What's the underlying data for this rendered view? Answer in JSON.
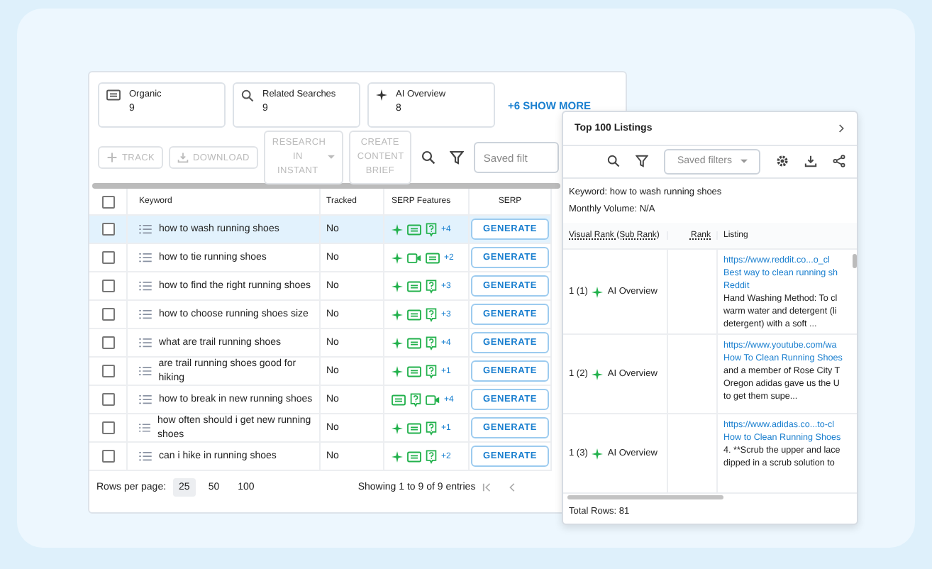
{
  "stats": [
    {
      "kind": "serp",
      "label": "Organic",
      "value": "9"
    },
    {
      "kind": "search",
      "label": "Related Searches",
      "value": "9"
    },
    {
      "kind": "ai",
      "label": "AI Overview",
      "value": "8"
    }
  ],
  "show_more": "+6 SHOW MORE",
  "toolbar": {
    "buttons": [
      {
        "kind": "plus",
        "label": "TRACK",
        "disabled": true
      },
      {
        "kind": "download",
        "label": "DOWNLOAD",
        "disabled": true
      },
      {
        "kind": "caret",
        "label": "RESEARCH IN INSTANT",
        "disabled": true
      },
      {
        "kind": "plain",
        "label": "CREATE CONTENT BRIEF",
        "disabled": true
      }
    ],
    "saved_filters": "Saved filt"
  },
  "table": {
    "all_checked": false,
    "columns": [
      "Keyword",
      "Tracked",
      "SERP Features",
      "SERP"
    ],
    "rows": [
      {
        "selected": true,
        "checked": false,
        "keyword": "how to wash running shoes",
        "tracked": "No",
        "features": [
          {
            "kind": "ai"
          },
          {
            "kind": "serp"
          },
          {
            "kind": "faq"
          }
        ],
        "more": "+4",
        "action": "GENERATE"
      },
      {
        "selected": false,
        "checked": false,
        "keyword": "how to tie running shoes",
        "tracked": "No",
        "features": [
          {
            "kind": "ai"
          },
          {
            "kind": "video"
          },
          {
            "kind": "serp"
          }
        ],
        "more": "+2",
        "action": "GENERATE"
      },
      {
        "selected": false,
        "checked": false,
        "keyword": "how to find the right running shoes",
        "tracked": "No",
        "features": [
          {
            "kind": "ai"
          },
          {
            "kind": "serp"
          },
          {
            "kind": "faq"
          }
        ],
        "more": "+3",
        "action": "GENERATE"
      },
      {
        "selected": false,
        "checked": false,
        "keyword": "how to choose running shoes size",
        "tracked": "No",
        "features": [
          {
            "kind": "ai"
          },
          {
            "kind": "serp"
          },
          {
            "kind": "faq"
          }
        ],
        "more": "+3",
        "action": "GENERATE"
      },
      {
        "selected": false,
        "checked": false,
        "keyword": "what are trail running shoes",
        "tracked": "No",
        "features": [
          {
            "kind": "ai"
          },
          {
            "kind": "serp"
          },
          {
            "kind": "faq"
          }
        ],
        "more": "+4",
        "action": "GENERATE"
      },
      {
        "selected": false,
        "checked": false,
        "keyword": "are trail running shoes good for hiking",
        "tracked": "No",
        "features": [
          {
            "kind": "ai"
          },
          {
            "kind": "serp"
          },
          {
            "kind": "faq"
          }
        ],
        "more": "+1",
        "action": "GENERATE"
      },
      {
        "selected": false,
        "checked": false,
        "keyword": "how to break in new running shoes",
        "tracked": "No",
        "features": [
          {
            "kind": "serp"
          },
          {
            "kind": "faq"
          },
          {
            "kind": "video"
          }
        ],
        "more": "+4",
        "action": "GENERATE"
      },
      {
        "selected": false,
        "checked": false,
        "keyword": "how often should i get new running shoes",
        "tracked": "No",
        "features": [
          {
            "kind": "ai"
          },
          {
            "kind": "serp"
          },
          {
            "kind": "faq"
          }
        ],
        "more": "+1",
        "action": "GENERATE"
      },
      {
        "selected": false,
        "checked": false,
        "keyword": "can i hike in running shoes",
        "tracked": "No",
        "features": [
          {
            "kind": "ai"
          },
          {
            "kind": "serp"
          },
          {
            "kind": "faq"
          }
        ],
        "more": "+2",
        "action": "GENERATE"
      }
    ]
  },
  "pagination": {
    "label": "Rows per page:",
    "sizes": [
      {
        "label": "25",
        "selected": true
      },
      {
        "label": "50",
        "selected": false
      },
      {
        "label": "100",
        "selected": false
      }
    ],
    "summary": "Showing 1 to 9 of 9 entries"
  },
  "popup": {
    "title": "Top 100 Listings",
    "saved_filters": "Saved filters",
    "keyword": "Keyword: how to wash running shoes",
    "volume": "Monthly Volume: N/A",
    "columns": [
      "Visual Rank (Sub Rank)",
      "Rank",
      "Listing"
    ],
    "rows": [
      {
        "rank": "1 (1)",
        "feature": "AI Overview",
        "url": "https://www.reddit.co...o_cl",
        "title_lines": [
          "Best way to clean running sh",
          "Reddit"
        ],
        "snippet_lines": [
          "Hand Washing Method: To cl",
          "warm water and detergent (li",
          "detergent) with a soft ..."
        ]
      },
      {
        "rank": "1 (2)",
        "feature": "AI Overview",
        "url": "https://www.youtube.com/wa",
        "title_lines": [
          "How To Clean Running Shoes"
        ],
        "snippet_lines": [
          "and a member of Rose City T",
          "Oregon adidas gave us the U",
          "to get them supe..."
        ]
      },
      {
        "rank": "1 (3)",
        "feature": "AI Overview",
        "url": "https://www.adidas.co...to-cl",
        "title_lines": [
          "How to Clean Running Shoes"
        ],
        "snippet_lines": [
          "4. **Scrub the upper and lace",
          "dipped in a scrub solution to"
        ]
      }
    ],
    "total": "Total Rows: 81"
  }
}
